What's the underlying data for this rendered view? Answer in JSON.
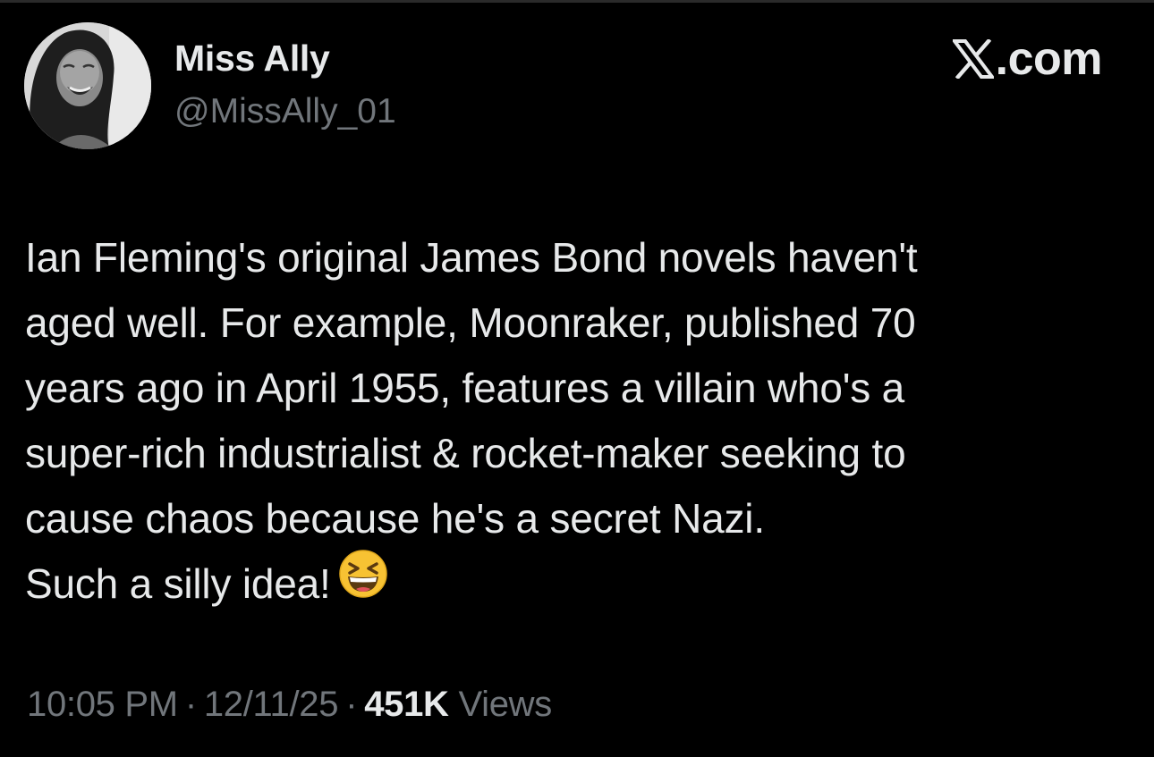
{
  "author": {
    "display_name": "Miss Ally",
    "handle": "@MissAlly_01",
    "avatar_icon": "profile-photo"
  },
  "brand": {
    "logo_icon": "x-logo-icon",
    "text": ".com"
  },
  "tweet": {
    "lines": [
      "Ian Fleming's original James Bond novels haven't",
      "aged well. For example, Moonraker, published 70",
      "years ago in April 1955, features a villain who's a",
      "super-rich industrialist & rocket-maker seeking to",
      "cause chaos because he's a secret Nazi.",
      "Such a silly idea!"
    ],
    "emoji": "grinning-squinting-face-icon"
  },
  "meta": {
    "time": "10:05 PM",
    "separator": "·",
    "date": "12/11/25",
    "views_count": "451K",
    "views_label": "Views"
  },
  "colors": {
    "background": "#000000",
    "primary_text": "#e7e9ea",
    "secondary_text": "#71767b"
  }
}
